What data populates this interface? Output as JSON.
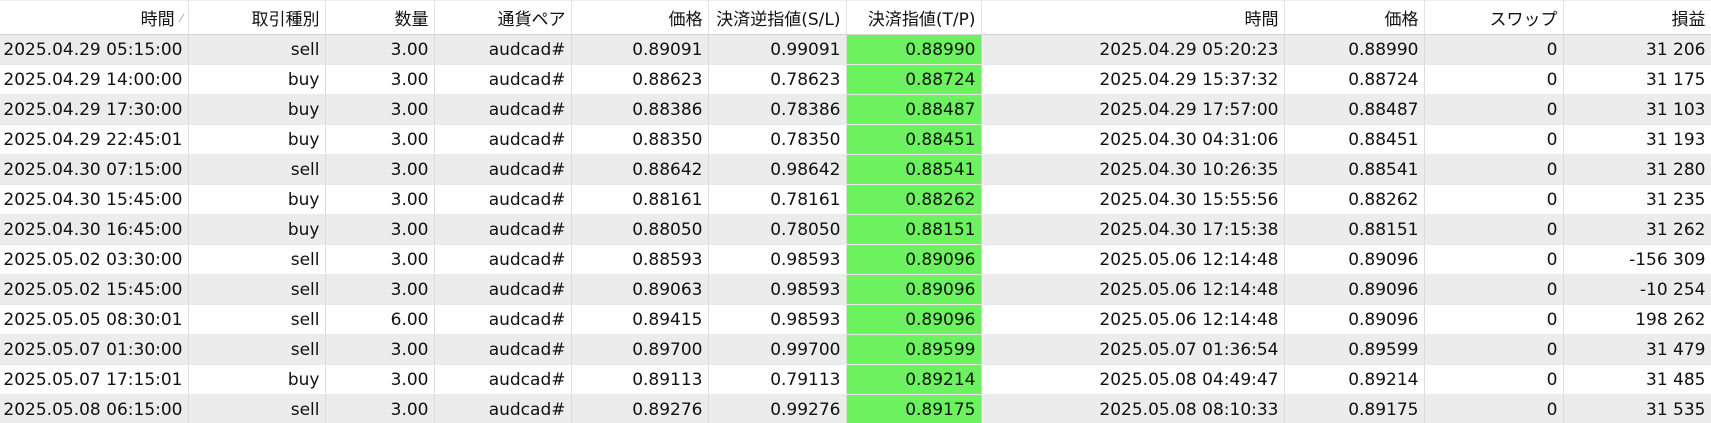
{
  "headers": {
    "time": "時間",
    "time_sort_glyph": "⁄",
    "type": "取引種別",
    "volume": "数量",
    "symbol": "通貨ペア",
    "price": "価格",
    "sl": "決済逆指値(S/L)",
    "tp": "決済指値(T/P)",
    "close_time": "時間",
    "close_price": "価格",
    "swap": "スワップ",
    "profit": "損益"
  },
  "colors": {
    "tp_highlight": "#6cf25e",
    "row_alt": "#ececec"
  },
  "rows": [
    {
      "time": "2025.04.29 05:15:00",
      "type": "sell",
      "volume": "3.00",
      "symbol": "audcad#",
      "price": "0.89091",
      "sl": "0.99091",
      "tp": "0.88990",
      "close_time": "2025.04.29 05:20:23",
      "close_price": "0.88990",
      "swap": "0",
      "profit": "31 206"
    },
    {
      "time": "2025.04.29 14:00:00",
      "type": "buy",
      "volume": "3.00",
      "symbol": "audcad#",
      "price": "0.88623",
      "sl": "0.78623",
      "tp": "0.88724",
      "close_time": "2025.04.29 15:37:32",
      "close_price": "0.88724",
      "swap": "0",
      "profit": "31 175"
    },
    {
      "time": "2025.04.29 17:30:00",
      "type": "buy",
      "volume": "3.00",
      "symbol": "audcad#",
      "price": "0.88386",
      "sl": "0.78386",
      "tp": "0.88487",
      "close_time": "2025.04.29 17:57:00",
      "close_price": "0.88487",
      "swap": "0",
      "profit": "31 103"
    },
    {
      "time": "2025.04.29 22:45:01",
      "type": "buy",
      "volume": "3.00",
      "symbol": "audcad#",
      "price": "0.88350",
      "sl": "0.78350",
      "tp": "0.88451",
      "close_time": "2025.04.30 04:31:06",
      "close_price": "0.88451",
      "swap": "0",
      "profit": "31 193"
    },
    {
      "time": "2025.04.30 07:15:00",
      "type": "sell",
      "volume": "3.00",
      "symbol": "audcad#",
      "price": "0.88642",
      "sl": "0.98642",
      "tp": "0.88541",
      "close_time": "2025.04.30 10:26:35",
      "close_price": "0.88541",
      "swap": "0",
      "profit": "31 280"
    },
    {
      "time": "2025.04.30 15:45:00",
      "type": "buy",
      "volume": "3.00",
      "symbol": "audcad#",
      "price": "0.88161",
      "sl": "0.78161",
      "tp": "0.88262",
      "close_time": "2025.04.30 15:55:56",
      "close_price": "0.88262",
      "swap": "0",
      "profit": "31 235"
    },
    {
      "time": "2025.04.30 16:45:00",
      "type": "buy",
      "volume": "3.00",
      "symbol": "audcad#",
      "price": "0.88050",
      "sl": "0.78050",
      "tp": "0.88151",
      "close_time": "2025.04.30 17:15:38",
      "close_price": "0.88151",
      "swap": "0",
      "profit": "31 262"
    },
    {
      "time": "2025.05.02 03:30:00",
      "type": "sell",
      "volume": "3.00",
      "symbol": "audcad#",
      "price": "0.88593",
      "sl": "0.98593",
      "tp": "0.89096",
      "close_time": "2025.05.06 12:14:48",
      "close_price": "0.89096",
      "swap": "0",
      "profit": "-156 309"
    },
    {
      "time": "2025.05.02 15:45:00",
      "type": "sell",
      "volume": "3.00",
      "symbol": "audcad#",
      "price": "0.89063",
      "sl": "0.98593",
      "tp": "0.89096",
      "close_time": "2025.05.06 12:14:48",
      "close_price": "0.89096",
      "swap": "0",
      "profit": "-10 254"
    },
    {
      "time": "2025.05.05 08:30:01",
      "type": "sell",
      "volume": "6.00",
      "symbol": "audcad#",
      "price": "0.89415",
      "sl": "0.98593",
      "tp": "0.89096",
      "close_time": "2025.05.06 12:14:48",
      "close_price": "0.89096",
      "swap": "0",
      "profit": "198 262"
    },
    {
      "time": "2025.05.07 01:30:00",
      "type": "sell",
      "volume": "3.00",
      "symbol": "audcad#",
      "price": "0.89700",
      "sl": "0.99700",
      "tp": "0.89599",
      "close_time": "2025.05.07 01:36:54",
      "close_price": "0.89599",
      "swap": "0",
      "profit": "31 479"
    },
    {
      "time": "2025.05.07 17:15:01",
      "type": "buy",
      "volume": "3.00",
      "symbol": "audcad#",
      "price": "0.89113",
      "sl": "0.79113",
      "tp": "0.89214",
      "close_time": "2025.05.08 04:49:47",
      "close_price": "0.89214",
      "swap": "0",
      "profit": "31 485"
    },
    {
      "time": "2025.05.08 06:15:00",
      "type": "sell",
      "volume": "3.00",
      "symbol": "audcad#",
      "price": "0.89276",
      "sl": "0.99276",
      "tp": "0.89175",
      "close_time": "2025.05.08 08:10:33",
      "close_price": "0.89175",
      "swap": "0",
      "profit": "31 535"
    }
  ]
}
